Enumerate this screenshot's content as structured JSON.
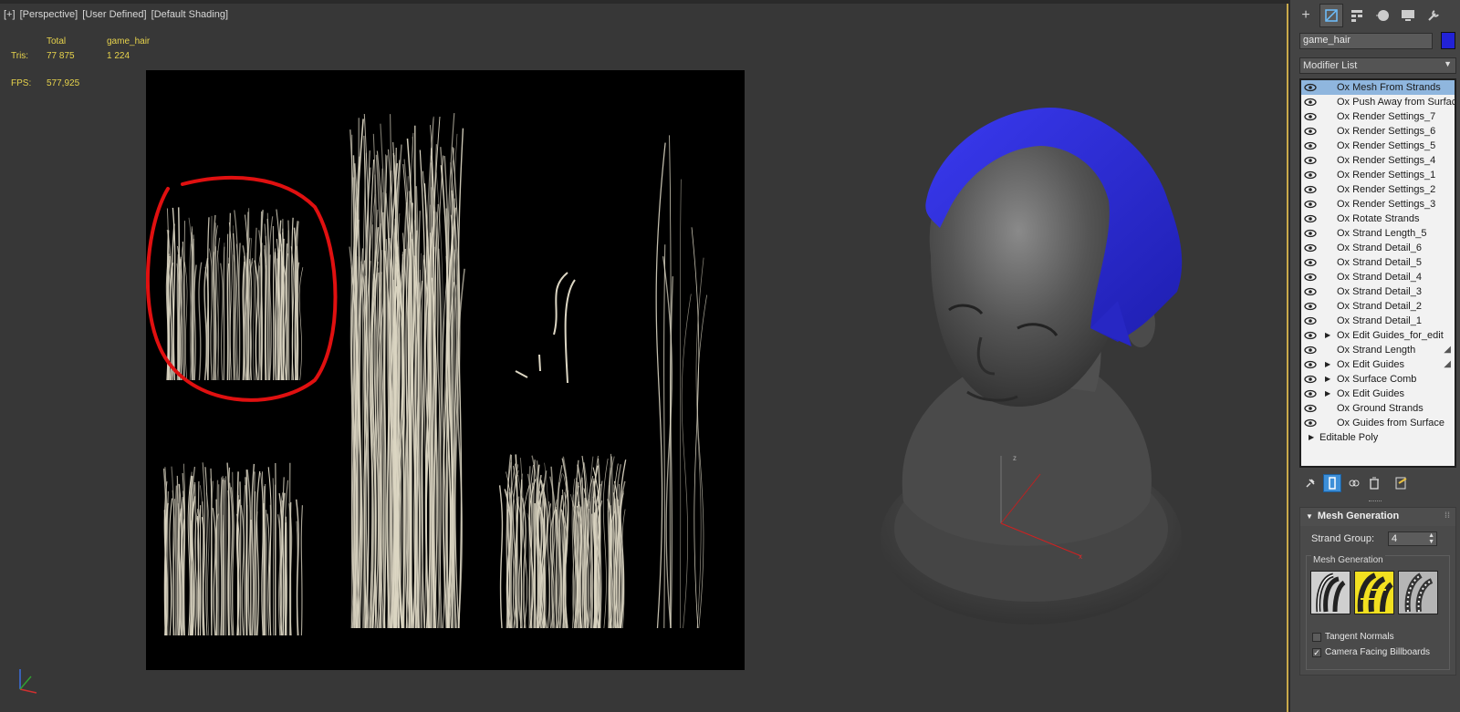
{
  "viewport": {
    "labels": [
      "[+]",
      "[Perspective]",
      "[User Defined]",
      "[Default Shading]"
    ],
    "stats": {
      "total_header": "Total",
      "object_header": "game_hair",
      "tris_label": "Tris:",
      "tris_total": "77 875",
      "tris_object": "1 224",
      "fps_label": "FPS:",
      "fps_value": "577,925"
    },
    "hair_color": "#dcd6c3",
    "highlight_circle_color": "#e01010",
    "hair_mesh_color": "#2b2bd0"
  },
  "panel": {
    "tabs": [
      "create-icon",
      "modify-icon",
      "hierarchy-icon",
      "motion-icon",
      "display-icon",
      "utilities-icon"
    ],
    "object_name": "game_hair",
    "object_color": "#2222d6",
    "modifier_list_label": "Modifier List",
    "stack": [
      {
        "label": "Ox Mesh From Strands",
        "selected": true,
        "expand": false,
        "brush": false
      },
      {
        "label": "Ox Push Away from Surface",
        "selected": false,
        "expand": false,
        "brush": false
      },
      {
        "label": "Ox Render Settings_7",
        "selected": false,
        "expand": false,
        "brush": false
      },
      {
        "label": "Ox Render Settings_6",
        "selected": false,
        "expand": false,
        "brush": false
      },
      {
        "label": "Ox Render Settings_5",
        "selected": false,
        "expand": false,
        "brush": false
      },
      {
        "label": "Ox Render Settings_4",
        "selected": false,
        "expand": false,
        "brush": false
      },
      {
        "label": "Ox Render Settings_1",
        "selected": false,
        "expand": false,
        "brush": false
      },
      {
        "label": "Ox Render Settings_2",
        "selected": false,
        "expand": false,
        "brush": false
      },
      {
        "label": "Ox Render Settings_3",
        "selected": false,
        "expand": false,
        "brush": false
      },
      {
        "label": "Ox Rotate Strands",
        "selected": false,
        "expand": false,
        "brush": false
      },
      {
        "label": "Ox Strand Length_5",
        "selected": false,
        "expand": false,
        "brush": false
      },
      {
        "label": "Ox Strand Detail_6",
        "selected": false,
        "expand": false,
        "brush": false
      },
      {
        "label": "Ox Strand Detail_5",
        "selected": false,
        "expand": false,
        "brush": false
      },
      {
        "label": "Ox Strand Detail_4",
        "selected": false,
        "expand": false,
        "brush": false
      },
      {
        "label": "Ox Strand Detail_3",
        "selected": false,
        "expand": false,
        "brush": false
      },
      {
        "label": "Ox Strand Detail_2",
        "selected": false,
        "expand": false,
        "brush": false
      },
      {
        "label": "Ox Strand Detail_1",
        "selected": false,
        "expand": false,
        "brush": false
      },
      {
        "label": "Ox Edit Guides_for_edit",
        "selected": false,
        "expand": true,
        "brush": false
      },
      {
        "label": "Ox Strand Length",
        "selected": false,
        "expand": false,
        "brush": true
      },
      {
        "label": "Ox Edit Guides",
        "selected": false,
        "expand": true,
        "brush": true
      },
      {
        "label": "Ox Surface Comb",
        "selected": false,
        "expand": true,
        "brush": false
      },
      {
        "label": "Ox Edit Guides",
        "selected": false,
        "expand": true,
        "brush": false
      },
      {
        "label": "Ox Ground Strands",
        "selected": false,
        "expand": false,
        "brush": false
      },
      {
        "label": "Ox Guides from Surface",
        "selected": false,
        "expand": false,
        "brush": false
      }
    ],
    "base_object": "Editable Poly",
    "stack_tools": [
      "pin-stack-icon",
      "show-end-result-icon",
      "make-unique-icon",
      "remove-modifier-icon",
      "configure-sets-icon"
    ],
    "rollout": {
      "title": "Mesh Generation",
      "strand_group_label": "Strand Group:",
      "strand_group_value": "4",
      "group_title": "Mesh Generation",
      "mesh_types": [
        "vertex-strips-icon",
        "billboard-strips-icon",
        "tubes-icon"
      ],
      "tangent_normals_label": "Tangent Normals",
      "tangent_normals_checked": false,
      "camera_facing_label": "Camera Facing Billboards",
      "camera_facing_checked": true
    }
  }
}
